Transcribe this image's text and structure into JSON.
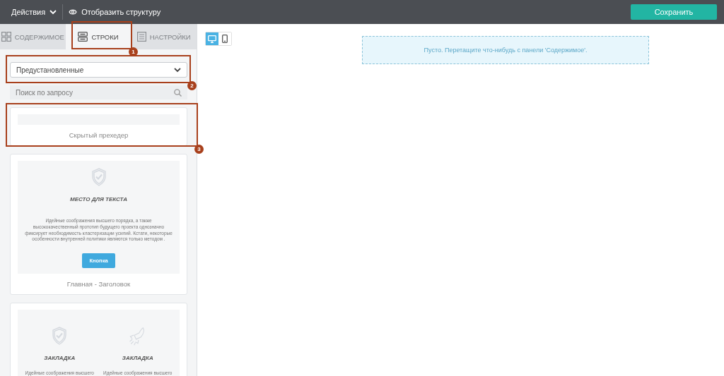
{
  "topbar": {
    "actions_menu": "Действия",
    "structure_toggle": "Отобразить структуру",
    "save_button": "Сохранить"
  },
  "tabs": [
    {
      "kind": "content",
      "label": "СОДЕРЖИМОЕ",
      "selected": false
    },
    {
      "kind": "rows",
      "label": "СТРОКИ",
      "selected": true
    },
    {
      "kind": "settings",
      "label": "НАСТРОЙКИ",
      "selected": false
    }
  ],
  "preset_select": {
    "value": "Предустановленные"
  },
  "search": {
    "placeholder": "Поиск по запросу"
  },
  "row_templates": [
    {
      "kind": "blank",
      "label": "Скрытый прехедер"
    },
    {
      "kind": "hero",
      "title": "МЕСТО ДЛЯ ТЕКСТА",
      "text": "Идейные соображения высшего порядка, а также высококачественный прототип будущего проекта однозначно фиксирует необходимость кластеризации усилий. Кстати, некоторые особенности внутренней политики являются только методом .",
      "button": "Кнопка",
      "label": "Главная - Заголовок"
    },
    {
      "kind": "two_column",
      "columns": [
        {
          "kind": "shield",
          "title": "ЗАКЛАДКА",
          "text": "Идейные соображения высшего"
        },
        {
          "kind": "rocket",
          "title": "ЗАКЛАДКА",
          "text": "Идейные соображения высшего"
        }
      ]
    }
  ],
  "device_toggle": [
    {
      "kind": "desktop",
      "selected": true
    },
    {
      "kind": "mobile",
      "selected": false
    }
  ],
  "canvas": {
    "empty_message": "Пусто. Перетащите что-нибудь с панели 'Содержимое'."
  },
  "annotations": [
    {
      "number": "1"
    },
    {
      "number": "2"
    },
    {
      "number": "3"
    }
  ]
}
